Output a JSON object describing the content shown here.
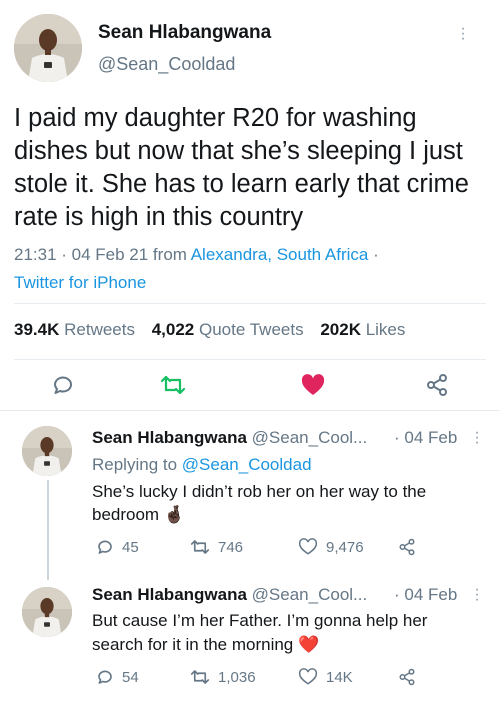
{
  "main_tweet": {
    "author_name": "Sean Hlabangwana",
    "author_handle": "@Sean_Cooldad",
    "text": "I paid my daughter R20 for washing dishes but now that she’s sleeping I just stole it. She has to learn early that crime rate is high in this country",
    "time": "21:31 · 04 Feb 21 from ",
    "location": "Alexandra, South Africa",
    "sep": " ·",
    "client": "Twitter for iPhone",
    "retweets_count": "39.4K",
    "retweets_label": "Retweets",
    "quotes_count": "4,022",
    "quotes_label": "Quote Tweets",
    "likes_count": "202K",
    "likes_label": "Likes"
  },
  "replies": [
    {
      "author_name": "Sean Hlabangwana",
      "author_handle": "@Sean_Cool...",
      "date": "· 04 Feb",
      "replying_prefix": "Replying to ",
      "replying_to": "@Sean_Cooldad",
      "line1": "She’s lucky I didn’t rob her on her way to the",
      "line2": "bedroom",
      "emoji": "🤞🏿",
      "reply_count": "45",
      "retweet_count": "746",
      "like_count": "9,476"
    },
    {
      "author_name": "Sean Hlabangwana",
      "author_handle": "@Sean_Cool...",
      "date": "· 04 Feb",
      "line1": "But cause I’m her Father. I’m gonna help her",
      "line2": "search for it in the morning",
      "emoji": "❤️",
      "reply_count": "54",
      "retweet_count": "1,036",
      "like_count": "14K"
    }
  ],
  "colors": {
    "link": "#1b95e0",
    "secondary": "#657786",
    "retweet_green": "#17bf63",
    "like_red": "#e0245e",
    "divider": "#e6ecf0"
  },
  "icons": [
    "more-icon",
    "reply-icon",
    "retweet-icon",
    "like-icon",
    "share-icon"
  ]
}
